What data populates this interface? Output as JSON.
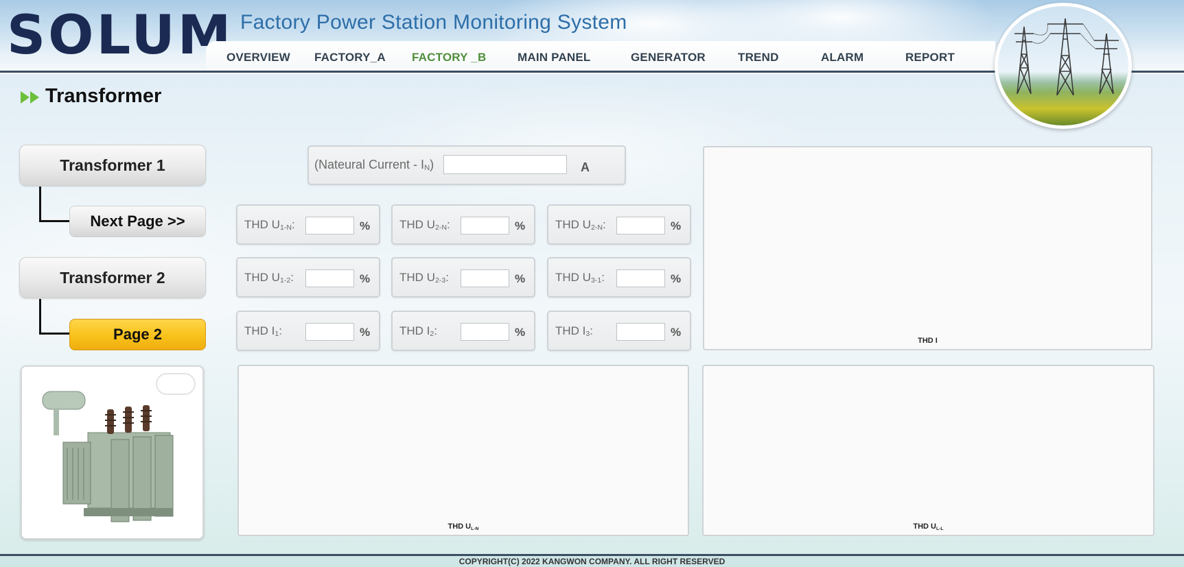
{
  "app": {
    "logo_text": "SOLUM",
    "title": "Factory Power Station Monitoring System"
  },
  "nav": {
    "items": [
      {
        "label": "OVERVIEW"
      },
      {
        "label": "FACTORY_A"
      },
      {
        "label": "FACTORY _B",
        "active": true
      },
      {
        "label": "MAIN PANEL"
      },
      {
        "label": "GENERATOR"
      },
      {
        "label": "TREND"
      },
      {
        "label": "ALARM"
      },
      {
        "label": "REPORT"
      }
    ]
  },
  "page": {
    "title": "Transformer"
  },
  "sidebar": {
    "transformer1": "Transformer 1",
    "next_page": "Next Page >>",
    "transformer2": "Transformer 2",
    "page2": "Page 2"
  },
  "current": {
    "label": "(Nateural Current - I",
    "label_sub": "N",
    "label_end": ")",
    "value": "",
    "unit": "A"
  },
  "thd_cards": [
    {
      "prefix": "THD U",
      "sub": "1-N",
      "suffix": ":",
      "value": "",
      "unit": "%"
    },
    {
      "prefix": "THD U",
      "sub": "2-N",
      "suffix": ":",
      "value": "",
      "unit": "%"
    },
    {
      "prefix": "THD U",
      "sub": "2-N",
      "suffix": ":",
      "value": "",
      "unit": "%"
    },
    {
      "prefix": "THD U",
      "sub": "1-2",
      "suffix": ":",
      "value": "",
      "unit": "%"
    },
    {
      "prefix": "THD U",
      "sub": "2-3",
      "suffix": ":",
      "value": "",
      "unit": "%"
    },
    {
      "prefix": "THD U",
      "sub": "3-1",
      "suffix": ":",
      "value": "",
      "unit": "%"
    },
    {
      "prefix": "THD I",
      "sub": "1",
      "suffix": ":",
      "value": "",
      "unit": "%"
    },
    {
      "prefix": "THD I",
      "sub": "2",
      "suffix": ":",
      "value": "",
      "unit": "%"
    },
    {
      "prefix": "THD I",
      "sub": "3",
      "suffix": ":",
      "value": "",
      "unit": "%"
    }
  ],
  "charts": {
    "thd_i": {
      "label": "THD I"
    },
    "thd_uln": {
      "label": "THD U",
      "sub": "L-N"
    },
    "thd_ull": {
      "label": "THD U",
      "sub": "L-L"
    }
  },
  "footer": {
    "text": "COPYRIGHT(C) 2022 KANGWON COMPANY. ALL RIGHT RESERVED"
  },
  "colors": {
    "brand_dark": "#1a2a52",
    "title_blue": "#2d6ea8",
    "nav_active": "#4f8f3c",
    "page2_gold": "#f8c21a",
    "arrow_green": "#6cbf3a"
  },
  "icons": {
    "title_marker": "double-arrow-icon"
  }
}
